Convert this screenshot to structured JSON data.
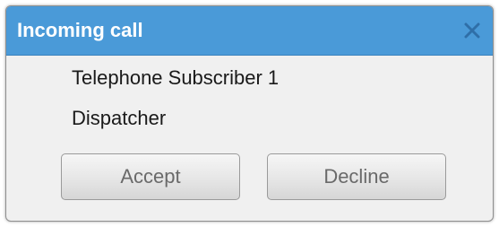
{
  "dialog": {
    "title": "Incoming call",
    "close_icon": "close-x-icon",
    "caller_name": "Telephone Subscriber 1",
    "caller_role": "Dispatcher",
    "accept_label": "Accept",
    "decline_label": "Decline"
  },
  "colors": {
    "titlebar": "#4a9ad8",
    "title_text": "#ffffff",
    "close_icon": "#2f6fa8",
    "body_background": "#f0f0f0",
    "button_text": "#6a6a6a"
  }
}
